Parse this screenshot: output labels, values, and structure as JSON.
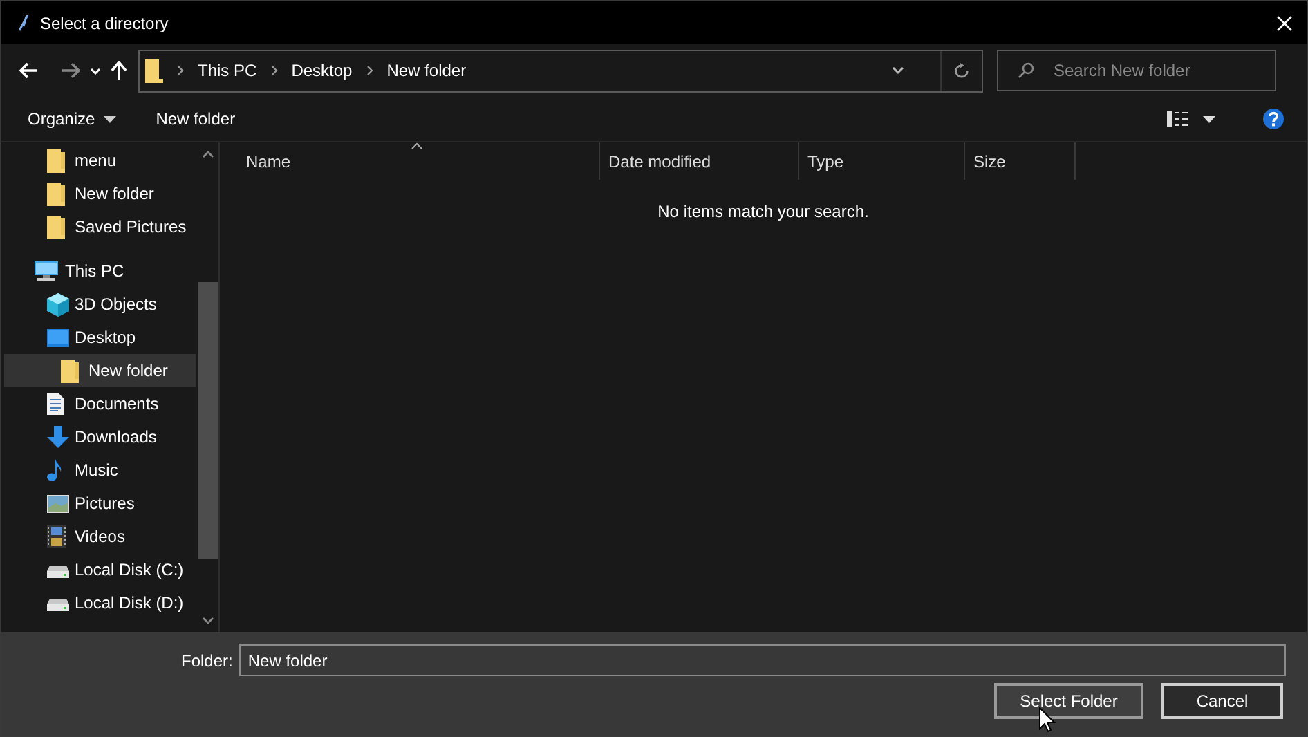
{
  "window": {
    "title": "Select a directory"
  },
  "address": {
    "crumbs": [
      "This PC",
      "Desktop",
      "New folder"
    ]
  },
  "search": {
    "placeholder": "Search New folder"
  },
  "toolbar": {
    "organize": "Organize",
    "new_folder": "New folder"
  },
  "sidebar": {
    "tree": [
      {
        "label": "menu",
        "kind": "folder",
        "selected": false
      },
      {
        "label": "New folder",
        "kind": "folder",
        "selected": false
      },
      {
        "label": "Saved Pictures",
        "kind": "folder",
        "selected": false
      },
      {
        "label": "This PC",
        "kind": "pc",
        "selected": false,
        "children": [
          {
            "label": "3D Objects",
            "kind": "cube",
            "selected": false
          },
          {
            "label": "Desktop",
            "kind": "desktop",
            "selected": false,
            "children": [
              {
                "label": "New folder",
                "kind": "folder",
                "selected": true
              }
            ]
          },
          {
            "label": "Documents",
            "kind": "documents",
            "selected": false
          },
          {
            "label": "Downloads",
            "kind": "downloads",
            "selected": false
          },
          {
            "label": "Music",
            "kind": "music",
            "selected": false
          },
          {
            "label": "Pictures",
            "kind": "pictures",
            "selected": false
          },
          {
            "label": "Videos",
            "kind": "videos",
            "selected": false
          },
          {
            "label": "Local Disk (C:)",
            "kind": "disk",
            "selected": false
          },
          {
            "label": "Local Disk (D:)",
            "kind": "disk",
            "selected": false
          }
        ]
      }
    ]
  },
  "table": {
    "columns": [
      "Name",
      "Date modified",
      "Type",
      "Size"
    ],
    "empty_message": "No items match your search."
  },
  "footer": {
    "folder_label": "Folder:",
    "folder_value": "New folder",
    "buttons": [
      "Select Folder",
      "Cancel"
    ]
  }
}
